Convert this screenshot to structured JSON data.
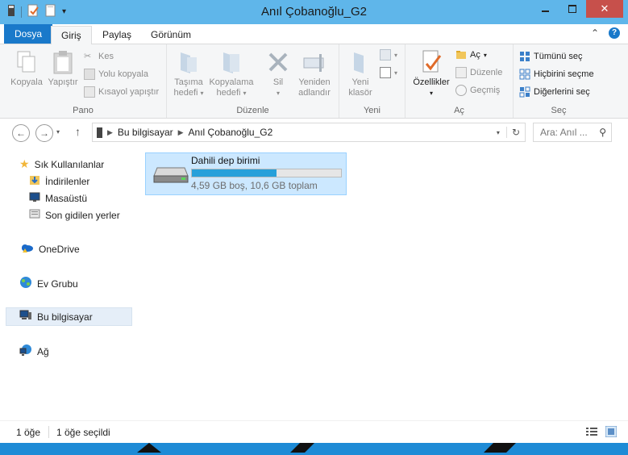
{
  "window": {
    "title": "Anıl Çobanoğlu_G2",
    "accent": "#1979ca",
    "title_bg": "#5fb6ea",
    "close_bg": "#c7504b"
  },
  "qat": {
    "items": [
      "drive-icon",
      "properties-icon",
      "new-folder-icon",
      "customize-chevron"
    ]
  },
  "tabs": {
    "file": "Dosya",
    "home": "Giriş",
    "share": "Paylaş",
    "view": "Görünüm"
  },
  "ribbon": {
    "pano": {
      "label": "Pano",
      "copy": "Kopyala",
      "paste": "Yapıştır",
      "cut": "Kes",
      "copy_path": "Yolu kopyala",
      "paste_shortcut": "Kısayol yapıştır"
    },
    "organize": {
      "label": "Düzenle",
      "move_to_1": "Taşıma",
      "move_to_2": "hedefi",
      "copy_to_1": "Kopyalama",
      "copy_to_2": "hedefi",
      "delete": "Sil",
      "rename_1": "Yeniden",
      "rename_2": "adlandır"
    },
    "new": {
      "label": "Yeni",
      "new_folder_1": "Yeni",
      "new_folder_2": "klasör"
    },
    "open": {
      "label": "Aç",
      "properties": "Özellikler",
      "open": "Aç",
      "edit": "Düzenle",
      "history": "Geçmiş"
    },
    "select": {
      "label": "Seç",
      "select_all": "Tümünü seç",
      "select_none": "Hiçbirini seçme",
      "invert": "Diğerlerini seç"
    }
  },
  "nav": {
    "breadcrumb": [
      "Bu bilgisayar",
      "Anıl Çobanoğlu_G2"
    ],
    "search_placeholder": "Ara: Anıl ..."
  },
  "sidebar": {
    "favorites": "Sık Kullanılanlar",
    "downloads": "İndirilenler",
    "desktop": "Masaüstü",
    "recent": "Son gidilen yerler",
    "onedrive": "OneDrive",
    "homegroup": "Ev Grubu",
    "thispc": "Bu bilgisayar",
    "network": "Ağ"
  },
  "drive": {
    "name": "Dahili dep birimi",
    "free_text": "4,59 GB boş, 10,6 GB toplam",
    "used_fraction": 0.567,
    "bar_color": "#26a0da"
  },
  "status": {
    "count": "1 öğe",
    "selected": "1 öğe seçildi"
  }
}
